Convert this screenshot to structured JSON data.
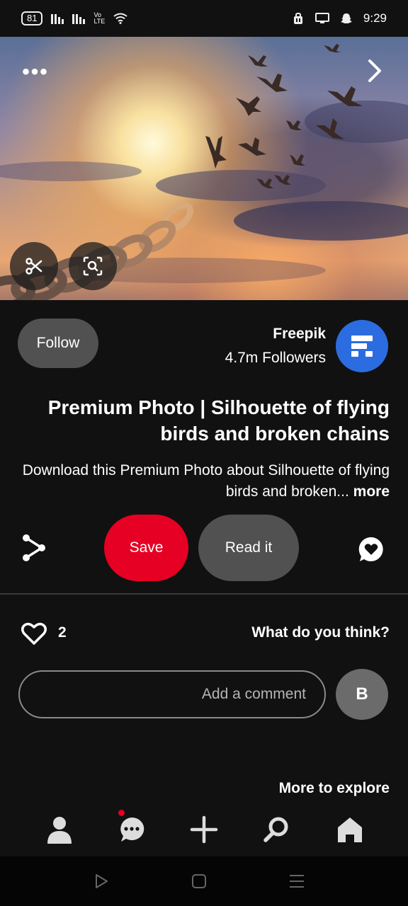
{
  "status_bar": {
    "battery": "81",
    "volte": [
      "Vo",
      "LTE"
    ],
    "time": "9:29",
    "icons": [
      "battery-icon",
      "signal-icon",
      "signal-icon",
      "volte-icon",
      "wifi-icon",
      "lock-icon",
      "screen-icon",
      "snapchat-icon"
    ]
  },
  "hero": {
    "more_label": "•••",
    "icons": [
      "more-icon",
      "chevron-right-icon",
      "scissors-icon",
      "lens-search-icon"
    ]
  },
  "creator": {
    "name": "Freepik",
    "followers": "4.7m Followers",
    "follow_label": "Follow"
  },
  "pin": {
    "title": "Premium Photo | Silhouette of flying birds and broken chains",
    "description": "Download this Premium Photo about Silhouette of flying birds and broken...",
    "more_label": "more"
  },
  "actions": {
    "read_label": "Read it",
    "save_label": "Save",
    "save_color": "#e60023"
  },
  "comments": {
    "prompt": "What do you think?",
    "like_count": "2",
    "input_placeholder": "Add a comment",
    "user_initial": "B"
  },
  "explore": {
    "heading": "More to explore"
  },
  "bottom_nav": {
    "icons": [
      "profile-icon",
      "chat-icon",
      "plus-icon",
      "search-icon",
      "home-icon"
    ]
  },
  "system_nav": {
    "icons": [
      "back-icon",
      "home-square-icon",
      "recents-icon"
    ]
  }
}
